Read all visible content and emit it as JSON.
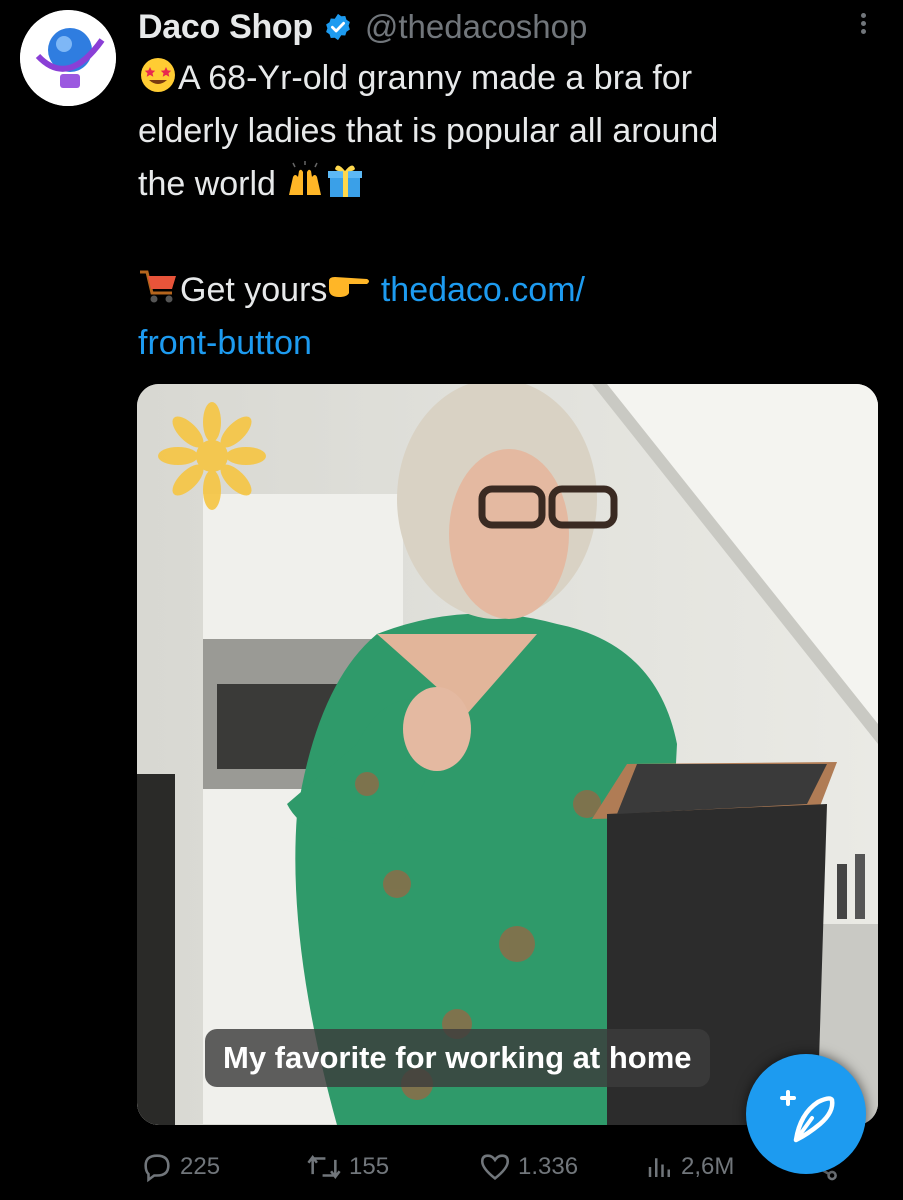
{
  "author": {
    "name": "Daco Shop",
    "handle": "@thedacoshop",
    "verified": true,
    "accent": "#1d9bf0"
  },
  "tweet": {
    "line1": "A 68-Yr-old granny made a bra for",
    "line2": "elderly ladies that is popular all around",
    "line3": "the world",
    "cta": "Get yours",
    "link_part1": "thedaco.com/",
    "link_part2": "front-button"
  },
  "media": {
    "caption": "My favorite for working at home"
  },
  "actions": {
    "replies": "225",
    "reposts": "155",
    "likes": "1.336",
    "views": "2,6M"
  },
  "icons": [
    "verified-badge-icon",
    "more-options-icon",
    "star-struck-emoji-icon",
    "raising-hands-emoji-icon",
    "gift-emoji-icon",
    "shopping-cart-emoji-icon",
    "pointing-right-emoji-icon",
    "reply-icon",
    "repost-icon",
    "like-icon",
    "views-icon",
    "share-icon",
    "compose-icon"
  ]
}
